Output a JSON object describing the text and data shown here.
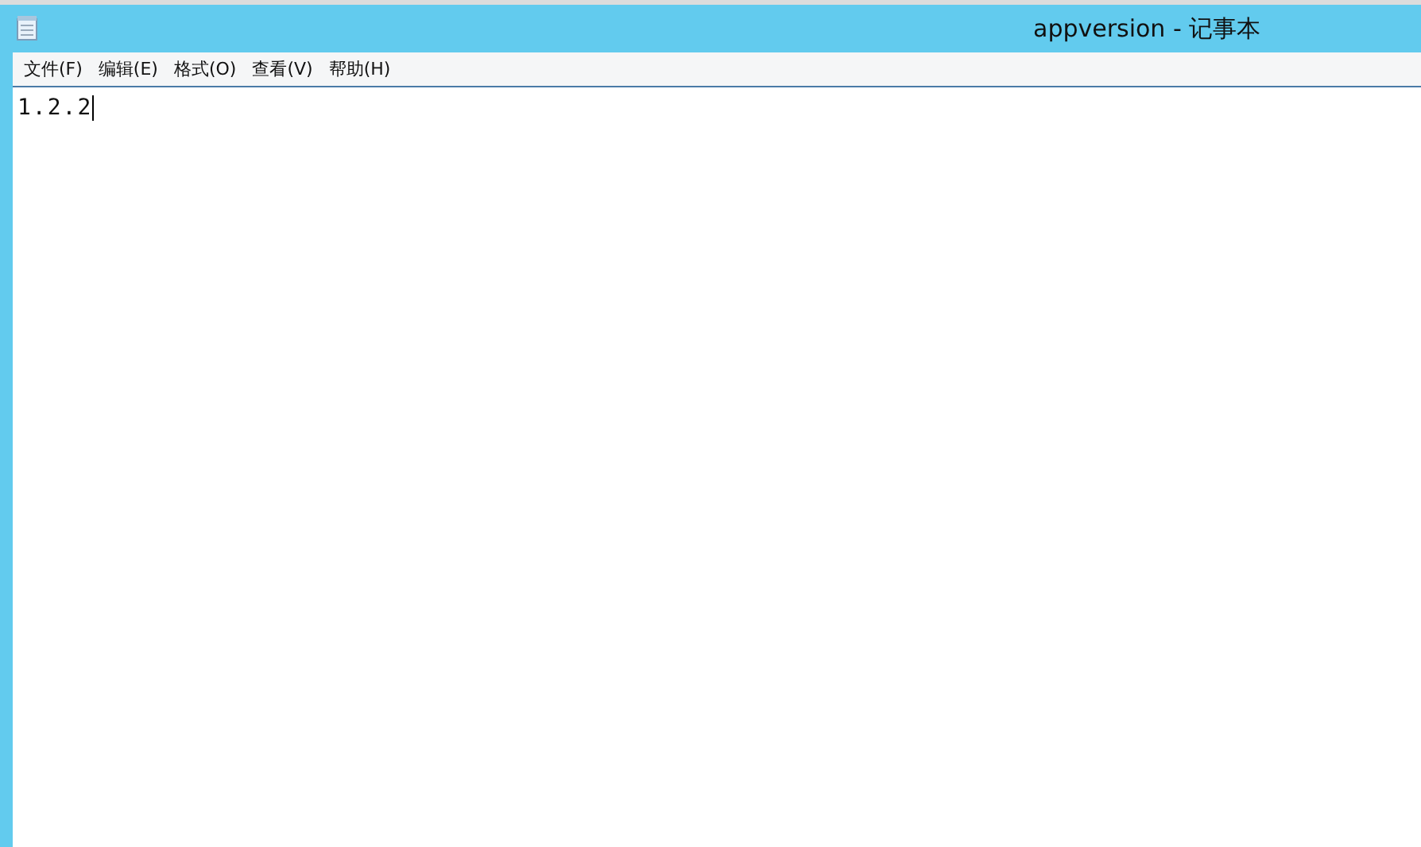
{
  "window": {
    "title": "appversion - 记事本"
  },
  "menu": [
    {
      "label": "文件(F)"
    },
    {
      "label": "编辑(E)"
    },
    {
      "label": "格式(O)"
    },
    {
      "label": "查看(V)"
    },
    {
      "label": "帮助(H)"
    }
  ],
  "editor": {
    "value": "1.2.2"
  }
}
